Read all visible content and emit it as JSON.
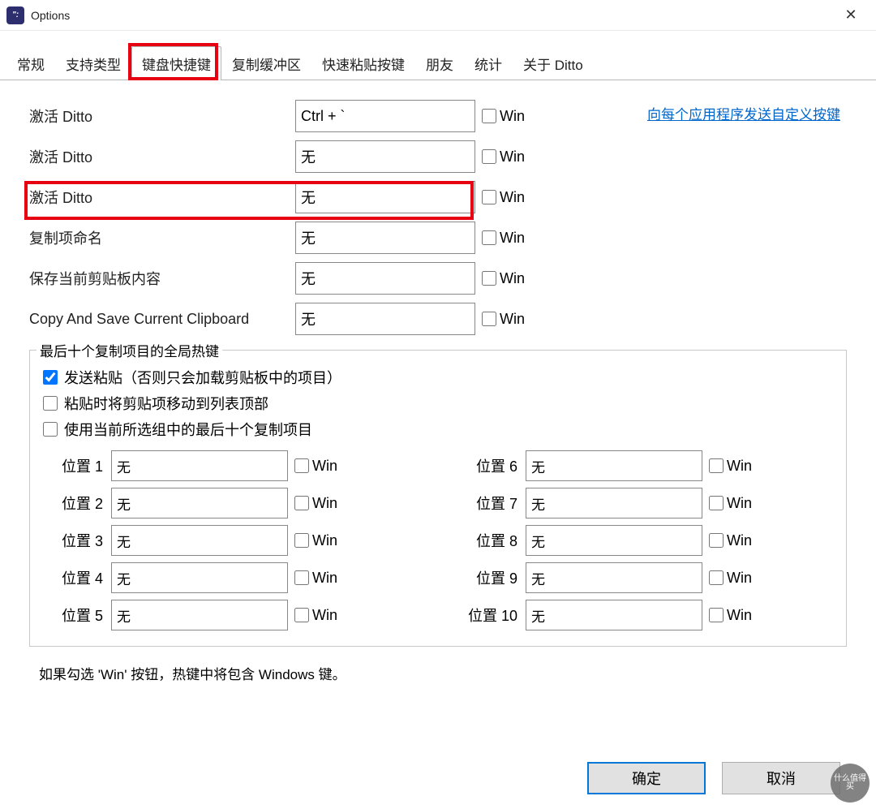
{
  "window": {
    "title": "Options"
  },
  "tabs": {
    "t1": "常规",
    "t2": "支持类型",
    "t3": "键盘快捷键",
    "t4": "复制缓冲区",
    "t5": "快速粘贴按键",
    "t6": "朋友",
    "t7": "统计",
    "t8": "关于 Ditto"
  },
  "link": "向每个应用程序发送自定义按键",
  "rows": [
    {
      "label": "激活 Ditto",
      "value": "Ctrl + `"
    },
    {
      "label": "激活 Ditto",
      "value": "无"
    },
    {
      "label": "激活 Ditto",
      "value": "无"
    },
    {
      "label": "复制项命名",
      "value": "无"
    },
    {
      "label": "保存当前剪贴板内容",
      "value": "无"
    },
    {
      "label": "Copy And Save Current Clipboard",
      "value": "无"
    }
  ],
  "winLabel": "Win",
  "group": {
    "title": "最后十个复制项目的全局热键",
    "chk1": "发送粘贴（否则只会加载剪贴板中的项目）",
    "chk2": "粘贴时将剪贴项移动到列表顶部",
    "chk3": "使用当前所选组中的最后十个复制项目",
    "posLabelPrefix": "位置",
    "posValue": "无"
  },
  "note": "如果勾选 'Win' 按钮，热键中将包含 Windows 键。",
  "buttons": {
    "ok": "确定",
    "cancel": "取消"
  },
  "watermark": "什么值得买"
}
